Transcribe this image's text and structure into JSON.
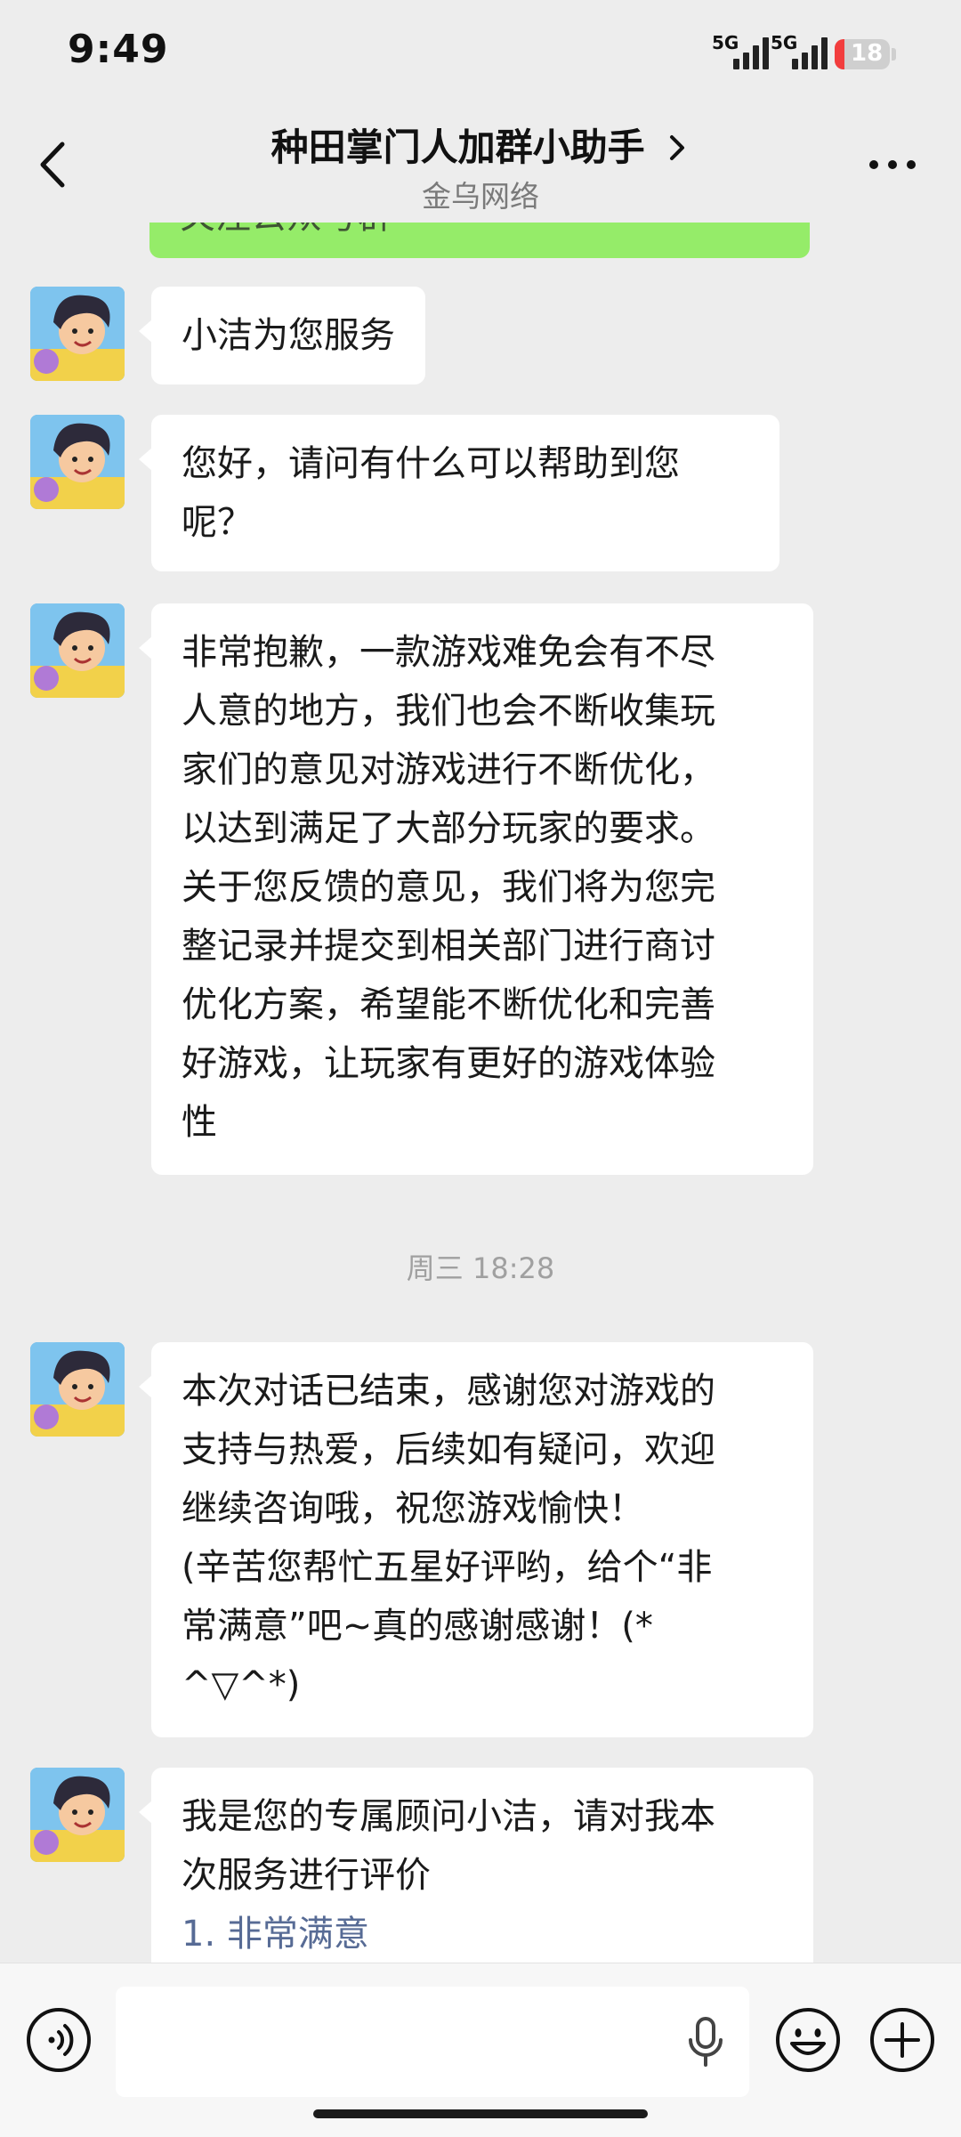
{
  "status_bar": {
    "time": "9:49",
    "signal_1_label": "5G",
    "signal_2_label": "5G",
    "battery_level": "18"
  },
  "header": {
    "title": "种田掌门人加群小助手",
    "subtitle": "金乌网络"
  },
  "top_partial_message": "关注公众号群",
  "messages": [
    {
      "text": "小洁为您服务"
    },
    {
      "text": "您好，请问有什么可以帮助到您\n呢？"
    },
    {
      "text": "非常抱歉，一款游戏难免会有不尽\n人意的地方，我们也会不断收集玩\n家们的意见对游戏进行不断优化，\n以达到满足了大部分玩家的要求。\n关于您反馈的意见，我们将为您完\n整记录并提交到相关部门进行商讨\n优化方案，希望能不断优化和完善\n好游戏，让玩家有更好的游戏体验\n性"
    },
    {
      "text": "本次对话已结束，感谢您对游戏的\n支持与热爱，后续如有疑问，欢迎\n继续咨询哦，祝您游戏愉快！\n(辛苦您帮忙五星好评哟，给个“非\n常满意”吧~真的感谢感谢！(*\n^▽^*)"
    },
    {
      "text": "我是您的专属顾问小洁，请对我本\n次服务进行评价",
      "option_link": "1. 非常满意"
    }
  ],
  "timestamp": "周三 18:28",
  "input": {
    "value": "",
    "placeholder": ""
  },
  "colors": {
    "background": "#ededed",
    "sent_bubble": "#95ec69",
    "received_bubble": "#ffffff",
    "link": "#576b95",
    "battery_low": "#f23d3d"
  },
  "icons": [
    "back-arrow-icon",
    "more-icon",
    "voice-icon",
    "mic-icon",
    "emoji-icon",
    "plus-icon"
  ]
}
